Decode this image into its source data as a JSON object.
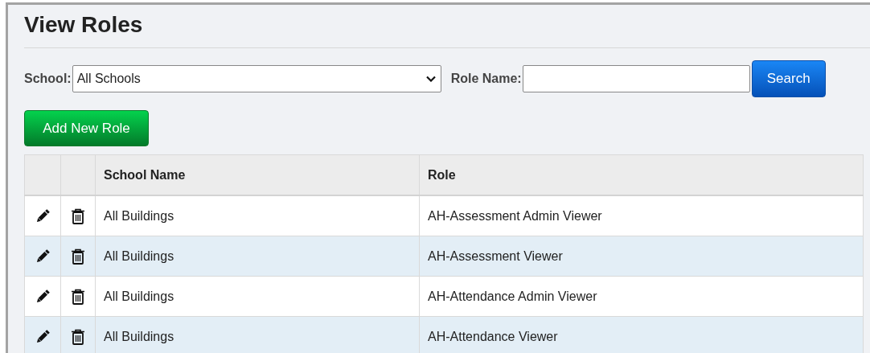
{
  "title": "View Roles",
  "filters": {
    "school_label": "School:",
    "school_value": "All Schools",
    "role_label": "Role Name:",
    "search_button": "Search"
  },
  "add_button": "Add New Role",
  "table": {
    "columns": [
      "School Name",
      "Role"
    ],
    "rows": [
      {
        "school": "All Buildings",
        "role": "AH-Assessment Admin Viewer"
      },
      {
        "school": "All Buildings",
        "role": "AH-Assessment Viewer"
      },
      {
        "school": "All Buildings",
        "role": "AH-Attendance Admin Viewer"
      },
      {
        "school": "All Buildings",
        "role": "AH-Attendance Viewer"
      }
    ]
  }
}
